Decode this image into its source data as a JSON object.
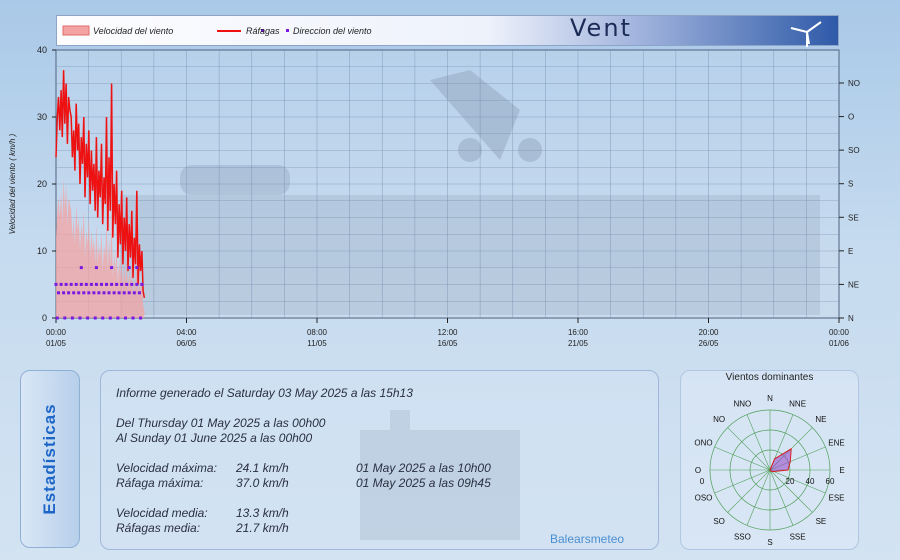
{
  "legend": {
    "wind_speed": "Velocidad del viento",
    "gusts": "Ráfagas",
    "direction": "Direccion del viento"
  },
  "banner_title": "Vent",
  "colors": {
    "speed_fill": "#f3a3a3",
    "gust_line": "#ee1111",
    "direction_dots": "#7a18e0",
    "grid": "#6f86a6"
  },
  "chart_data": {
    "type": "line",
    "ylabel": "Velocidad del viento ( km/h )",
    "ylim": [
      0,
      40
    ],
    "y_ticks": [
      "0",
      "10",
      "20",
      "30",
      "40"
    ],
    "x_ticks": [
      {
        "time": "00:00",
        "date": "01/05"
      },
      {
        "time": "04:00",
        "date": "06/05"
      },
      {
        "time": "08:00",
        "date": "11/05"
      },
      {
        "time": "12:00",
        "date": "16/05"
      },
      {
        "time": "16:00",
        "date": "21/05"
      },
      {
        "time": "20:00",
        "date": "26/05"
      },
      {
        "time": "00:00",
        "date": "01/06"
      }
    ],
    "x_range_days": [
      0,
      31
    ],
    "dir_ticks": [
      "N",
      "NE",
      "E",
      "SE",
      "S",
      "SO",
      "O",
      "NO"
    ],
    "gust_samples_days": [
      0.0,
      0.05,
      0.1,
      0.15,
      0.2,
      0.25,
      0.3,
      0.35,
      0.4,
      0.45,
      0.5,
      0.55,
      0.6,
      0.65,
      0.7,
      0.75,
      0.8,
      0.85,
      0.9,
      0.95,
      1.0,
      1.05,
      1.1,
      1.15,
      1.2,
      1.25,
      1.3,
      1.35,
      1.4,
      1.45,
      1.5,
      1.55,
      1.6,
      1.65,
      1.7,
      1.75,
      1.8,
      1.85,
      1.9,
      1.95,
      2.0,
      2.05,
      2.1,
      2.15,
      2.2,
      2.25,
      2.3,
      2.35,
      2.4,
      2.45,
      2.5,
      2.55,
      2.6,
      2.65,
      2.7,
      2.75,
      2.8,
      2.85,
      2.9,
      2.95,
      3.0,
      3.05,
      3.1,
      3.15,
      3.2,
      3.25,
      3.3,
      3.35,
      3.4,
      3.45,
      3.5
    ],
    "gusts": [
      24,
      30,
      33,
      28,
      34,
      27,
      37,
      29,
      35,
      26,
      33,
      31,
      30,
      24,
      28,
      22,
      32,
      25,
      29,
      20,
      27,
      23,
      30,
      18,
      26,
      21,
      28,
      17,
      25,
      19,
      23,
      16,
      27,
      15,
      22,
      18,
      26,
      14,
      21,
      17,
      30,
      13,
      24,
      16,
      35,
      12,
      20,
      14,
      22,
      9,
      17,
      11,
      19,
      8,
      15,
      10,
      18,
      7,
      14,
      9,
      16,
      6,
      12,
      8,
      19,
      5,
      11,
      7,
      10,
      4,
      3
    ],
    "speed": [
      12,
      16,
      18,
      15,
      19,
      14,
      21,
      16,
      20,
      14,
      18,
      17,
      16,
      12,
      15,
      11,
      17,
      13,
      15,
      10,
      14,
      12,
      16,
      9,
      13,
      11,
      15,
      9,
      13,
      10,
      12,
      8,
      14,
      8,
      11,
      9,
      13,
      7,
      11,
      9,
      15,
      7,
      12,
      8,
      16,
      6,
      10,
      7,
      11,
      5,
      9,
      6,
      10,
      4,
      8,
      5,
      9,
      4,
      7,
      5,
      8,
      3,
      6,
      4,
      9,
      3,
      6,
      4,
      5,
      2,
      1
    ],
    "direction_days": [
      0.0,
      0.2,
      0.4,
      0.6,
      0.8,
      1.0,
      1.2,
      1.4,
      1.6,
      1.8,
      2.0,
      2.2,
      2.4,
      2.6,
      2.8,
      3.0,
      3.2,
      3.4,
      0.1,
      0.3,
      0.5,
      0.7,
      0.9,
      1.1,
      1.3,
      1.5,
      1.7,
      1.9,
      2.1,
      2.3,
      2.5,
      2.7,
      2.9,
      3.1,
      3.3,
      0.05,
      0.35,
      0.65,
      0.95,
      1.25,
      1.55,
      1.85,
      2.15,
      2.45,
      2.75,
      3.05,
      3.35,
      1.0,
      1.6,
      2.2,
      2.9,
      3.2
    ],
    "direction_sector": [
      1,
      1,
      1,
      1,
      1,
      1,
      1,
      1,
      1,
      1,
      1,
      1,
      1,
      1,
      1,
      1,
      1,
      1,
      0.75,
      0.75,
      0.75,
      0.75,
      0.75,
      0.75,
      0.75,
      0.75,
      0.75,
      0.75,
      0.75,
      0.75,
      0.75,
      0.75,
      0.75,
      0.75,
      0.75,
      0,
      0,
      0,
      0,
      0,
      0,
      0,
      0,
      0,
      0,
      0,
      0,
      1.5,
      1.5,
      1.5,
      1.5,
      1.5
    ]
  },
  "stats": {
    "tab_label": "Estadísticas",
    "report_line": "Informe generado el Saturday 03 May 2025 a las 15h13",
    "from_line": "Del Thursday 01 May 2025 a las 00h00",
    "to_line": "Al Sunday 01 June 2025 a las 00h00",
    "max_speed_label": "Velocidad máxima:",
    "max_speed_value": "24.1 km/h",
    "max_speed_time": "01 May 2025 a las 10h00",
    "max_gust_label": "Ráfaga máxima:",
    "max_gust_value": "37.0 km/h",
    "max_gust_time": "01 May 2025 a las 09h45",
    "avg_speed_label": "Velocidad media:",
    "avg_speed_value": "13.3 km/h",
    "avg_gust_label": "Ráfagas media:",
    "avg_gust_value": "21.7 km/h",
    "brand": "Balearsmeteo"
  },
  "rose": {
    "title": "Vientos dominantes",
    "directions": [
      "N",
      "NNE",
      "NE",
      "ENE",
      "E",
      "ESE",
      "SE",
      "SSE",
      "S",
      "SSO",
      "SO",
      "OSO",
      "O",
      "ONO",
      "NO",
      "NNO"
    ],
    "scale_labels": [
      "0",
      "20",
      "40",
      "60"
    ],
    "max": 60,
    "values": [
      0,
      12,
      30,
      22,
      18,
      4,
      2,
      0,
      0,
      0,
      0,
      0,
      0,
      0,
      0,
      0
    ]
  }
}
